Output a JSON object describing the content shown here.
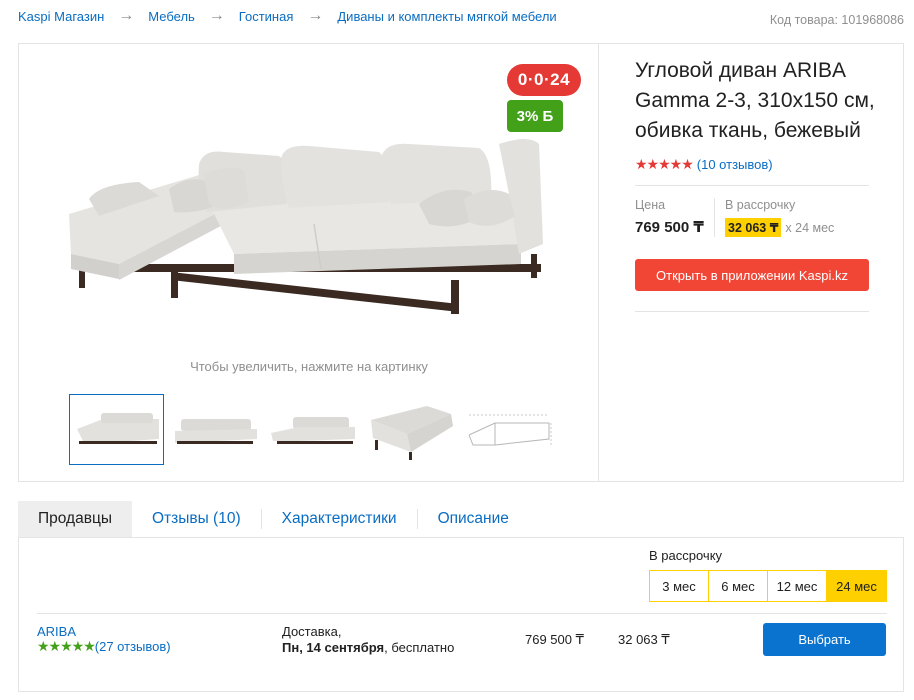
{
  "breadcrumbs": [
    "Kaspi Магазин",
    "Мебель",
    "Гостиная",
    "Диваны и комплекты мягкой мебели"
  ],
  "breadcrumb_separator": "→",
  "sku": "Код товара: 101968086",
  "product": {
    "title": "Угловой диван ARIBA Gamma 2-3, 310x150 см, обивка ткань, бежевый",
    "stars": "★★★★★",
    "reviews_link": "(10 отзывов)",
    "price_label": "Цена",
    "price": "769 500 ₸",
    "installment_label": "В рассрочку",
    "installment_amount": "32 063 ₸",
    "installment_term": "x 24 мес",
    "open_app_button": "Открыть в приложении Kaspi.kz"
  },
  "gallery": {
    "badge_installment": "0·0·24",
    "badge_bonus": "3% Б",
    "zoom_hint": "Чтобы увеличить, нажмите на картинку",
    "thumbnail_count": 5,
    "active_thumbnail": 1
  },
  "tabs": [
    "Продавцы",
    "Отзывы (10)",
    "Характеристики",
    "Описание"
  ],
  "active_tab": 0,
  "sellers": {
    "installment_label": "В рассрочку",
    "months": [
      "3 мес",
      "6 мес",
      "12 мес",
      "24 мес"
    ],
    "active_month": 3,
    "rows": [
      {
        "name": "ARIBA",
        "stars": "★★★★★",
        "reviews": "(27 отзывов)",
        "delivery_line1": "Доставка,",
        "delivery_date": "Пн, 14 сентября",
        "delivery_rest": ", бесплатно",
        "price": "769 500 ₸",
        "installment": "32 063 ₸",
        "button": "Выбрать"
      }
    ]
  },
  "colors": {
    "link": "#0a6dc2",
    "accent_red": "#f14635",
    "badge_green": "#43a019",
    "highlight_yellow": "#ffd000",
    "button_blue": "#0a73cf"
  }
}
